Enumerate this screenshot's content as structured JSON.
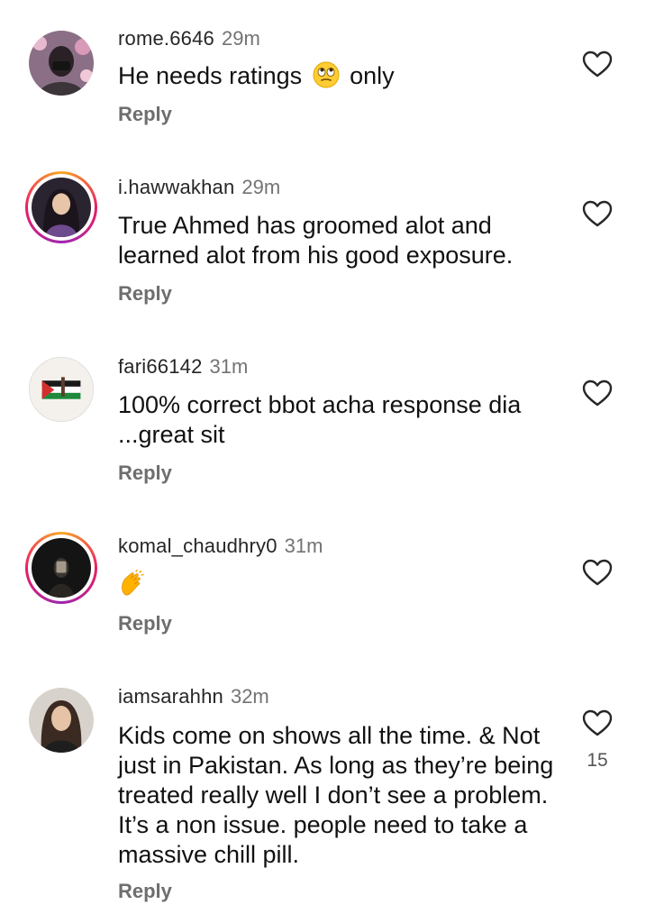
{
  "comments": [
    {
      "username": "rome.6646",
      "time": "29m",
      "text_before": "He needs ratings ",
      "emoji": "face-with-rolling-eyes-emoji",
      "text_after": " only",
      "reply_label": "Reply",
      "like_icon": "heart-outline-icon"
    },
    {
      "username": "i.hawwakhan",
      "time": "29m",
      "text": "True Ahmed has groomed alot and learned alot from his good exposure.",
      "reply_label": "Reply",
      "like_icon": "heart-outline-icon"
    },
    {
      "username": "fari66142",
      "time": "31m",
      "text": "100% correct bbot acha response dia ...great sit",
      "reply_label": "Reply",
      "like_icon": "heart-outline-icon"
    },
    {
      "username": "komal_chaudhry0",
      "time": "31m",
      "emoji": "clapping-hands-emoji",
      "reply_label": "Reply",
      "like_icon": "heart-outline-icon"
    },
    {
      "username": "iamsarahhn",
      "time": "32m",
      "text": "Kids come on shows all the time. & Not just in Pakistan. As long as they’re being treated really well I don’t see a problem. It’s a non issue. people need to take a massive chill pill.",
      "reply_label": "Reply",
      "like_icon": "heart-outline-icon",
      "like_count": "15"
    }
  ],
  "colors": {
    "username": "#262626",
    "timestamp": "#737373",
    "reply": "#6e6e6e",
    "story_ring_start": "#f9a825",
    "story_ring_end": "#9c27b0"
  }
}
